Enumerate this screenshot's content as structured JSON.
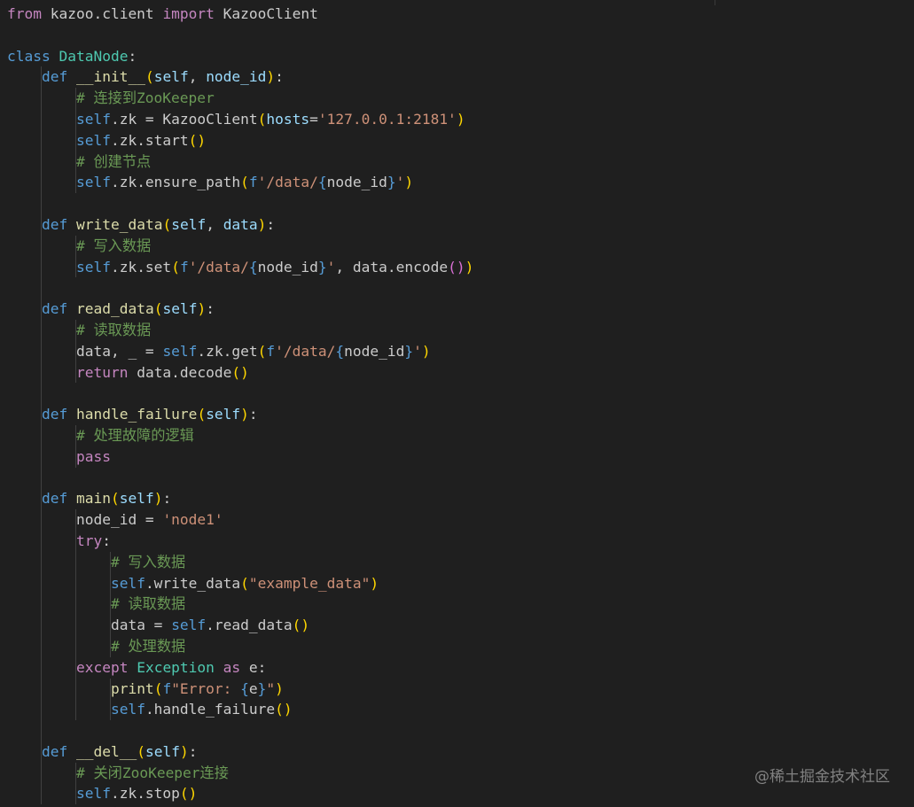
{
  "colors": {
    "background": "#1f1f1f",
    "keyword": "#569cd6",
    "control": "#c586c0",
    "function": "#dcdcaa",
    "class": "#4ec9b0",
    "variable": "#9cdcfe",
    "string": "#ce9178",
    "comment": "#6a9955",
    "plain": "#cccccc",
    "bracket1": "#ffd700",
    "bracket2": "#da70d6",
    "bracket3": "#179fff"
  },
  "code_lines": [
    [
      {
        "t": "from",
        "c": "control"
      },
      {
        "t": " kazoo.client ",
        "c": "plain"
      },
      {
        "t": "import",
        "c": "control"
      },
      {
        "t": " KazooClient",
        "c": "plain"
      }
    ],
    [],
    [
      {
        "t": "class",
        "c": "keyword"
      },
      {
        "t": " ",
        "c": "plain"
      },
      {
        "t": "DataNode",
        "c": "class"
      },
      {
        "t": ":",
        "c": "plain"
      }
    ],
    [
      {
        "t": "    ",
        "c": "plain"
      },
      {
        "t": "def",
        "c": "keyword"
      },
      {
        "t": " ",
        "c": "plain"
      },
      {
        "t": "__init__",
        "c": "function"
      },
      {
        "t": "(",
        "c": "bracket1"
      },
      {
        "t": "self",
        "c": "variable"
      },
      {
        "t": ", ",
        "c": "plain"
      },
      {
        "t": "node_id",
        "c": "variable"
      },
      {
        "t": ")",
        "c": "bracket1"
      },
      {
        "t": ":",
        "c": "plain"
      }
    ],
    [
      {
        "t": "        ",
        "c": "plain"
      },
      {
        "t": "# 连接到ZooKeeper",
        "c": "comment"
      }
    ],
    [
      {
        "t": "        ",
        "c": "plain"
      },
      {
        "t": "self",
        "c": "keyword"
      },
      {
        "t": ".zk = KazooClient",
        "c": "plain"
      },
      {
        "t": "(",
        "c": "bracket1"
      },
      {
        "t": "hosts",
        "c": "variable"
      },
      {
        "t": "=",
        "c": "plain"
      },
      {
        "t": "'127.0.0.1:2181'",
        "c": "string"
      },
      {
        "t": ")",
        "c": "bracket1"
      }
    ],
    [
      {
        "t": "        ",
        "c": "plain"
      },
      {
        "t": "self",
        "c": "keyword"
      },
      {
        "t": ".zk.start",
        "c": "plain"
      },
      {
        "t": "()",
        "c": "bracket1"
      }
    ],
    [
      {
        "t": "        ",
        "c": "plain"
      },
      {
        "t": "# 创建节点",
        "c": "comment"
      }
    ],
    [
      {
        "t": "        ",
        "c": "plain"
      },
      {
        "t": "self",
        "c": "keyword"
      },
      {
        "t": ".zk.ensure_path",
        "c": "plain"
      },
      {
        "t": "(",
        "c": "bracket1"
      },
      {
        "t": "f",
        "c": "keyword"
      },
      {
        "t": "'/data/",
        "c": "string"
      },
      {
        "t": "{",
        "c": "keyword"
      },
      {
        "t": "node_id",
        "c": "plain"
      },
      {
        "t": "}",
        "c": "keyword"
      },
      {
        "t": "'",
        "c": "string"
      },
      {
        "t": ")",
        "c": "bracket1"
      }
    ],
    [],
    [
      {
        "t": "    ",
        "c": "plain"
      },
      {
        "t": "def",
        "c": "keyword"
      },
      {
        "t": " ",
        "c": "plain"
      },
      {
        "t": "write_data",
        "c": "function"
      },
      {
        "t": "(",
        "c": "bracket1"
      },
      {
        "t": "self",
        "c": "variable"
      },
      {
        "t": ", ",
        "c": "plain"
      },
      {
        "t": "data",
        "c": "variable"
      },
      {
        "t": ")",
        "c": "bracket1"
      },
      {
        "t": ":",
        "c": "plain"
      }
    ],
    [
      {
        "t": "        ",
        "c": "plain"
      },
      {
        "t": "# 写入数据",
        "c": "comment"
      }
    ],
    [
      {
        "t": "        ",
        "c": "plain"
      },
      {
        "t": "self",
        "c": "keyword"
      },
      {
        "t": ".zk.set",
        "c": "plain"
      },
      {
        "t": "(",
        "c": "bracket1"
      },
      {
        "t": "f",
        "c": "keyword"
      },
      {
        "t": "'/data/",
        "c": "string"
      },
      {
        "t": "{",
        "c": "keyword"
      },
      {
        "t": "node_id",
        "c": "plain"
      },
      {
        "t": "}",
        "c": "keyword"
      },
      {
        "t": "'",
        "c": "string"
      },
      {
        "t": ", data.encode",
        "c": "plain"
      },
      {
        "t": "()",
        "c": "bracket2"
      },
      {
        "t": ")",
        "c": "bracket1"
      }
    ],
    [],
    [
      {
        "t": "    ",
        "c": "plain"
      },
      {
        "t": "def",
        "c": "keyword"
      },
      {
        "t": " ",
        "c": "plain"
      },
      {
        "t": "read_data",
        "c": "function"
      },
      {
        "t": "(",
        "c": "bracket1"
      },
      {
        "t": "self",
        "c": "variable"
      },
      {
        "t": ")",
        "c": "bracket1"
      },
      {
        "t": ":",
        "c": "plain"
      }
    ],
    [
      {
        "t": "        ",
        "c": "plain"
      },
      {
        "t": "# 读取数据",
        "c": "comment"
      }
    ],
    [
      {
        "t": "        ",
        "c": "plain"
      },
      {
        "t": "data, _ = ",
        "c": "plain"
      },
      {
        "t": "self",
        "c": "keyword"
      },
      {
        "t": ".zk.get",
        "c": "plain"
      },
      {
        "t": "(",
        "c": "bracket1"
      },
      {
        "t": "f",
        "c": "keyword"
      },
      {
        "t": "'/data/",
        "c": "string"
      },
      {
        "t": "{",
        "c": "keyword"
      },
      {
        "t": "node_id",
        "c": "plain"
      },
      {
        "t": "}",
        "c": "keyword"
      },
      {
        "t": "'",
        "c": "string"
      },
      {
        "t": ")",
        "c": "bracket1"
      }
    ],
    [
      {
        "t": "        ",
        "c": "plain"
      },
      {
        "t": "return",
        "c": "control"
      },
      {
        "t": " data.decode",
        "c": "plain"
      },
      {
        "t": "()",
        "c": "bracket1"
      }
    ],
    [],
    [
      {
        "t": "    ",
        "c": "plain"
      },
      {
        "t": "def",
        "c": "keyword"
      },
      {
        "t": " ",
        "c": "plain"
      },
      {
        "t": "handle_failure",
        "c": "function"
      },
      {
        "t": "(",
        "c": "bracket1"
      },
      {
        "t": "self",
        "c": "variable"
      },
      {
        "t": ")",
        "c": "bracket1"
      },
      {
        "t": ":",
        "c": "plain"
      }
    ],
    [
      {
        "t": "        ",
        "c": "plain"
      },
      {
        "t": "# 处理故障的逻辑",
        "c": "comment"
      }
    ],
    [
      {
        "t": "        ",
        "c": "plain"
      },
      {
        "t": "pass",
        "c": "control"
      }
    ],
    [],
    [
      {
        "t": "    ",
        "c": "plain"
      },
      {
        "t": "def",
        "c": "keyword"
      },
      {
        "t": " ",
        "c": "plain"
      },
      {
        "t": "main",
        "c": "function"
      },
      {
        "t": "(",
        "c": "bracket1"
      },
      {
        "t": "self",
        "c": "variable"
      },
      {
        "t": ")",
        "c": "bracket1"
      },
      {
        "t": ":",
        "c": "plain"
      }
    ],
    [
      {
        "t": "        ",
        "c": "plain"
      },
      {
        "t": "node_id = ",
        "c": "plain"
      },
      {
        "t": "'node1'",
        "c": "string"
      }
    ],
    [
      {
        "t": "        ",
        "c": "plain"
      },
      {
        "t": "try",
        "c": "control"
      },
      {
        "t": ":",
        "c": "plain"
      }
    ],
    [
      {
        "t": "            ",
        "c": "plain"
      },
      {
        "t": "# 写入数据",
        "c": "comment"
      }
    ],
    [
      {
        "t": "            ",
        "c": "plain"
      },
      {
        "t": "self",
        "c": "keyword"
      },
      {
        "t": ".write_data",
        "c": "plain"
      },
      {
        "t": "(",
        "c": "bracket1"
      },
      {
        "t": "\"example_data\"",
        "c": "string"
      },
      {
        "t": ")",
        "c": "bracket1"
      }
    ],
    [
      {
        "t": "            ",
        "c": "plain"
      },
      {
        "t": "# 读取数据",
        "c": "comment"
      }
    ],
    [
      {
        "t": "            ",
        "c": "plain"
      },
      {
        "t": "data = ",
        "c": "plain"
      },
      {
        "t": "self",
        "c": "keyword"
      },
      {
        "t": ".read_data",
        "c": "plain"
      },
      {
        "t": "()",
        "c": "bracket1"
      }
    ],
    [
      {
        "t": "            ",
        "c": "plain"
      },
      {
        "t": "# 处理数据",
        "c": "comment"
      }
    ],
    [
      {
        "t": "        ",
        "c": "plain"
      },
      {
        "t": "except",
        "c": "control"
      },
      {
        "t": " ",
        "c": "plain"
      },
      {
        "t": "Exception",
        "c": "class"
      },
      {
        "t": " ",
        "c": "plain"
      },
      {
        "t": "as",
        "c": "control"
      },
      {
        "t": " e:",
        "c": "plain"
      }
    ],
    [
      {
        "t": "            ",
        "c": "plain"
      },
      {
        "t": "print",
        "c": "function"
      },
      {
        "t": "(",
        "c": "bracket1"
      },
      {
        "t": "f",
        "c": "keyword"
      },
      {
        "t": "\"Error: ",
        "c": "string"
      },
      {
        "t": "{",
        "c": "keyword"
      },
      {
        "t": "e",
        "c": "plain"
      },
      {
        "t": "}",
        "c": "keyword"
      },
      {
        "t": "\"",
        "c": "string"
      },
      {
        "t": ")",
        "c": "bracket1"
      }
    ],
    [
      {
        "t": "            ",
        "c": "plain"
      },
      {
        "t": "self",
        "c": "keyword"
      },
      {
        "t": ".handle_failure",
        "c": "plain"
      },
      {
        "t": "()",
        "c": "bracket1"
      }
    ],
    [],
    [
      {
        "t": "    ",
        "c": "plain"
      },
      {
        "t": "def",
        "c": "keyword"
      },
      {
        "t": " ",
        "c": "plain"
      },
      {
        "t": "__del__",
        "c": "function"
      },
      {
        "t": "(",
        "c": "bracket1"
      },
      {
        "t": "self",
        "c": "variable"
      },
      {
        "t": ")",
        "c": "bracket1"
      },
      {
        "t": ":",
        "c": "plain"
      }
    ],
    [
      {
        "t": "        ",
        "c": "plain"
      },
      {
        "t": "# 关闭ZooKeeper连接",
        "c": "comment"
      }
    ],
    [
      {
        "t": "        ",
        "c": "plain"
      },
      {
        "t": "self",
        "c": "keyword"
      },
      {
        "t": ".zk.stop",
        "c": "plain"
      },
      {
        "t": "()",
        "c": "bracket1"
      }
    ]
  ],
  "watermark": "@稀土掘金技术社区"
}
